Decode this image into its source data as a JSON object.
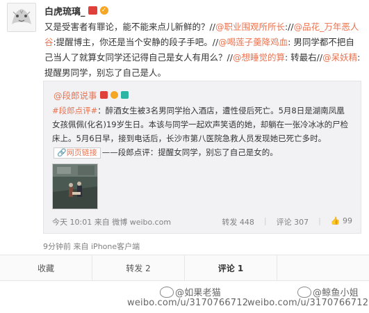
{
  "post": {
    "author": "白虎琉璃_",
    "text_segments": [
      {
        "t": "又是受害者有罪论，能不能来点儿新鲜的？//",
        "link": false
      },
      {
        "t": "@职业围观所所长",
        "link": true
      },
      {
        "t": ":",
        "link": false
      },
      {
        "t": "//",
        "link": false
      },
      {
        "t": "@品花_万年恶人谷",
        "link": true
      },
      {
        "t": ":提醒博主，你还是当个安静的段子手吧。//",
        "link": false
      },
      {
        "t": "@喝莲子羹降鸡血",
        "link": true
      },
      {
        "t": ": 男同学都不把自己当人了就算女同学还记得自己是女人有用么？//",
        "link": false
      },
      {
        "t": "@想睡觉的算",
        "link": true
      },
      {
        "t": ": 转最右//",
        "link": false
      },
      {
        "t": "@呆妖精",
        "link": true
      },
      {
        "t": ":提醒男同学，别忘了自己是人。",
        "link": false
      }
    ],
    "time": "9分钟前",
    "source_prefix": "来自",
    "source": "iPhone客户端"
  },
  "quoted": {
    "author": "@段郎说事",
    "hashtag": "#段郎点评#",
    "text_part1": "：醉酒女生被3名男同学抬入酒店，遭性侵后死亡。5月8日是湖南凤凰女孩佩佩(化名)19岁生日。本该与同学一起欢声笑语的她，却躺在一张冷冰冰的尸检床上。5月6日早，接到电话后，长沙市第八医院急救人员发现她已死亡多时。",
    "link_label": "网页链接",
    "text_part2": "——段郎点评：提醒女同学，别忘了自己是女的。",
    "time": "今天 10:01",
    "source_prefix": "来自",
    "source": "微博 weibo.com",
    "reposts": "转发 448",
    "comments": "评论 307",
    "likes": "99"
  },
  "actions": [
    {
      "label": "收藏"
    },
    {
      "label": "转发 2"
    },
    {
      "label": "评论 1"
    },
    {
      "label": ""
    }
  ],
  "watermark": {
    "name1": "@如果老猫",
    "name2": "@鲸鱼小姐",
    "url1": "weibo.com/u/3170766712",
    "url2": "weibo.com/u/3170766712"
  },
  "colors": {
    "link": "#eb7350",
    "meta": "#808080",
    "quote_bg": "#f2f2f5"
  }
}
